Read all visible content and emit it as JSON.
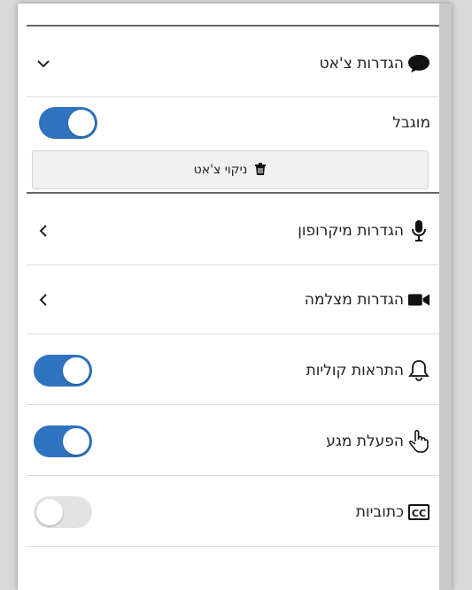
{
  "chat_settings": {
    "title": "הגדרות צ'אט",
    "icon": "chat-bubble-icon",
    "expanded": true
  },
  "restricted": {
    "label": "מוגבל",
    "enabled": true
  },
  "clear_chat": {
    "label": "ניקוי צ'אט",
    "icon": "trash-icon"
  },
  "microphone_settings": {
    "label": "הגדרות מיקרופון",
    "icon": "microphone-icon"
  },
  "camera_settings": {
    "label": "הגדרות מצלמה",
    "icon": "video-camera-icon"
  },
  "sound_alerts": {
    "label": "התראות קוליות",
    "icon": "bell-icon",
    "enabled": true
  },
  "touch_mode": {
    "label": "הפעלת מגע",
    "icon": "hand-pointer-icon",
    "enabled": true
  },
  "captions": {
    "label": "כתוביות",
    "icon": "closed-captions-icon",
    "enabled": false
  },
  "colors": {
    "toggle_on": "#2f73c1",
    "toggle_off": "#e3e3e3"
  }
}
